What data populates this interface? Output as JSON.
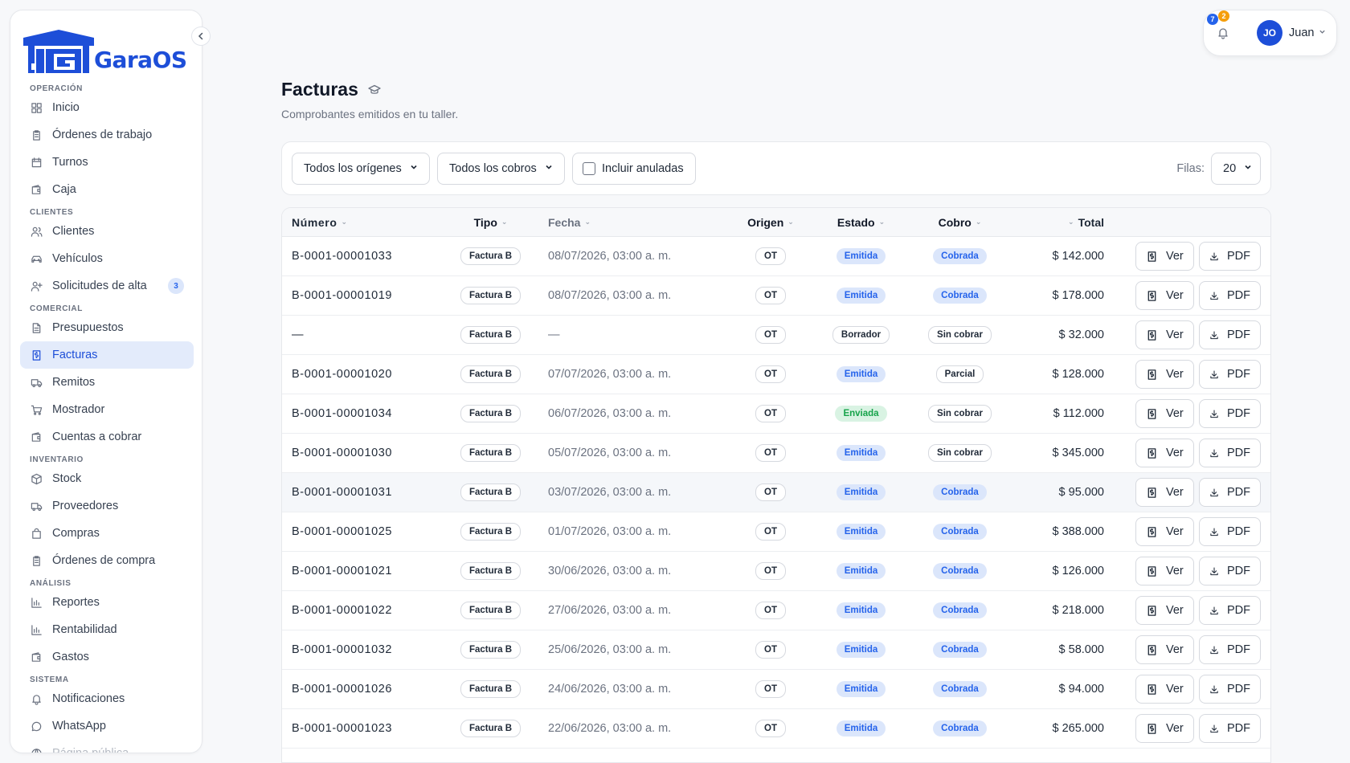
{
  "app": {
    "logo_text": "GaraOS"
  },
  "sidebar": {
    "sections": [
      {
        "title": "OPERACIÓN",
        "items": [
          {
            "label": "Inicio",
            "icon": "grid-icon"
          },
          {
            "label": "Órdenes de trabajo",
            "icon": "clipboard-icon"
          },
          {
            "label": "Turnos",
            "icon": "calendar-icon"
          },
          {
            "label": "Caja",
            "icon": "wallet-icon"
          }
        ]
      },
      {
        "title": "CLIENTES",
        "items": [
          {
            "label": "Clientes",
            "icon": "users-icon"
          },
          {
            "label": "Vehículos",
            "icon": "car-icon"
          },
          {
            "label": "Solicitudes de alta",
            "icon": "user-plus-icon",
            "badge": "3"
          }
        ]
      },
      {
        "title": "COMERCIAL",
        "items": [
          {
            "label": "Presupuestos",
            "icon": "document-icon"
          },
          {
            "label": "Facturas",
            "icon": "invoice-icon",
            "active": true
          },
          {
            "label": "Remitos",
            "icon": "truck-icon"
          },
          {
            "label": "Mostrador",
            "icon": "cart-icon"
          },
          {
            "label": "Cuentas a cobrar",
            "icon": "wallet-icon"
          }
        ]
      },
      {
        "title": "INVENTARIO",
        "items": [
          {
            "label": "Stock",
            "icon": "box-icon"
          },
          {
            "label": "Proveedores",
            "icon": "truck-icon"
          },
          {
            "label": "Compras",
            "icon": "bag-icon"
          },
          {
            "label": "Órdenes de compra",
            "icon": "clipboard-icon"
          }
        ]
      },
      {
        "title": "ANÁLISIS",
        "items": [
          {
            "label": "Reportes",
            "icon": "chart-icon"
          },
          {
            "label": "Rentabilidad",
            "icon": "chart-icon"
          },
          {
            "label": "Gastos",
            "icon": "wallet-icon"
          }
        ]
      },
      {
        "title": "SISTEMA",
        "items": [
          {
            "label": "Notificaciones",
            "icon": "bell-icon"
          },
          {
            "label": "WhatsApp",
            "icon": "chat-icon"
          },
          {
            "label": "Página pública",
            "icon": "globe-icon",
            "dim": true
          }
        ]
      }
    ]
  },
  "header": {
    "notif_count_blue": "7",
    "notif_count_orange": "2",
    "avatar_initials": "JO",
    "user_name": "Juan"
  },
  "page": {
    "title": "Facturas",
    "subtitle": "Comprobantes emitidos en tu taller."
  },
  "filters": {
    "origen_selected": "Todos los orígenes",
    "cobro_selected": "Todos los cobros",
    "anuladas_label": "Incluir anuladas",
    "rows_label": "Filas:",
    "rows_value": "20"
  },
  "table": {
    "columns": {
      "numero": "Número",
      "tipo": "Tipo",
      "fecha": "Fecha",
      "origen": "Origen",
      "estado": "Estado",
      "cobro": "Cobro",
      "total": "Total"
    },
    "actions": {
      "ver": "Ver",
      "pdf": "PDF"
    },
    "rows": [
      {
        "numero": "B-0001-00001033",
        "tipo": "Factura B",
        "fecha": "08/07/2026, 03:00 a. m.",
        "origen": "OT",
        "estado": "Emitida",
        "cobro": "Cobrada",
        "total": "$ 142.000"
      },
      {
        "numero": "B-0001-00001019",
        "tipo": "Factura B",
        "fecha": "08/07/2026, 03:00 a. m.",
        "origen": "OT",
        "estado": "Emitida",
        "cobro": "Cobrada",
        "total": "$ 178.000"
      },
      {
        "numero": "—",
        "tipo": "Factura B",
        "fecha": "—",
        "origen": "OT",
        "estado": "Borrador",
        "cobro": "Sin cobrar",
        "total": "$ 32.000"
      },
      {
        "numero": "B-0001-00001020",
        "tipo": "Factura B",
        "fecha": "07/07/2026, 03:00 a. m.",
        "origen": "OT",
        "estado": "Emitida",
        "cobro": "Parcial",
        "total": "$ 128.000"
      },
      {
        "numero": "B-0001-00001034",
        "tipo": "Factura B",
        "fecha": "06/07/2026, 03:00 a. m.",
        "origen": "OT",
        "estado": "Enviada",
        "cobro": "Sin cobrar",
        "total": "$ 112.000"
      },
      {
        "numero": "B-0001-00001030",
        "tipo": "Factura B",
        "fecha": "05/07/2026, 03:00 a. m.",
        "origen": "OT",
        "estado": "Emitida",
        "cobro": "Sin cobrar",
        "total": "$ 345.000"
      },
      {
        "numero": "B-0001-00001031",
        "tipo": "Factura B",
        "fecha": "03/07/2026, 03:00 a. m.",
        "origen": "OT",
        "estado": "Emitida",
        "cobro": "Cobrada",
        "total": "$ 95.000",
        "hl": true
      },
      {
        "numero": "B-0001-00001025",
        "tipo": "Factura B",
        "fecha": "01/07/2026, 03:00 a. m.",
        "origen": "OT",
        "estado": "Emitida",
        "cobro": "Cobrada",
        "total": "$ 388.000"
      },
      {
        "numero": "B-0001-00001021",
        "tipo": "Factura B",
        "fecha": "30/06/2026, 03:00 a. m.",
        "origen": "OT",
        "estado": "Emitida",
        "cobro": "Cobrada",
        "total": "$ 126.000"
      },
      {
        "numero": "B-0001-00001022",
        "tipo": "Factura B",
        "fecha": "27/06/2026, 03:00 a. m.",
        "origen": "OT",
        "estado": "Emitida",
        "cobro": "Cobrada",
        "total": "$ 218.000"
      },
      {
        "numero": "B-0001-00001032",
        "tipo": "Factura B",
        "fecha": "25/06/2026, 03:00 a. m.",
        "origen": "OT",
        "estado": "Emitida",
        "cobro": "Cobrada",
        "total": "$ 58.000"
      },
      {
        "numero": "B-0001-00001026",
        "tipo": "Factura B",
        "fecha": "24/06/2026, 03:00 a. m.",
        "origen": "OT",
        "estado": "Emitida",
        "cobro": "Cobrada",
        "total": "$ 94.000"
      },
      {
        "numero": "B-0001-00001023",
        "tipo": "Factura B",
        "fecha": "22/06/2026, 03:00 a. m.",
        "origen": "OT",
        "estado": "Emitida",
        "cobro": "Cobrada",
        "total": "$ 265.000"
      }
    ]
  },
  "colors": {
    "accent": "#1d4ed8",
    "badge_blue_bg": "#dbe6fb",
    "badge_green_bg": "#d9f3e3"
  }
}
